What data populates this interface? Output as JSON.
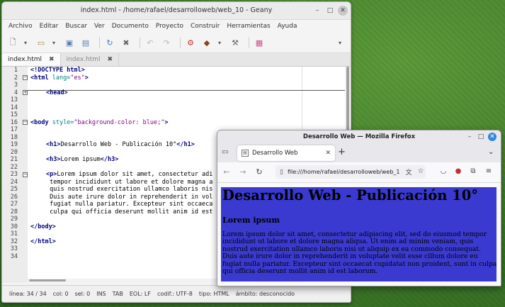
{
  "geany": {
    "title": "index.html - /home/rafael/desarrolloweb/web_10 - Geany",
    "menu": [
      "Archivo",
      "Editar",
      "Buscar",
      "Ver",
      "Documento",
      "Proyecto",
      "Construir",
      "Herramientas",
      "Ayuda"
    ],
    "tabs": [
      {
        "label": "index.html",
        "active": true
      },
      {
        "label": "index.html",
        "active": false
      }
    ],
    "line_numbers": [
      "1",
      "2",
      "3",
      "4",
      "13",
      "14",
      "15",
      "16",
      "17",
      "18",
      "19",
      "20",
      "21",
      "22",
      "23",
      "24",
      "25",
      "26",
      "27",
      "28",
      "29",
      "30",
      "31",
      "32",
      "33",
      "34"
    ],
    "code": {
      "l1": "<!DOCTYPE html>",
      "l2_tag": "<html",
      "l2_attr": " lang=",
      "l2_str": "\"es\"",
      "l2_end": ">",
      "l4": "<head>",
      "l16_tag": "<body",
      "l16_attr": " style=",
      "l16_str": "\"background-color: blue;\"",
      "l16_end": ">",
      "l19_open": "<h1>",
      "l19_text": "Desarrollo Web - Publicación 10°",
      "l19_close": "</h1>",
      "l21_open": "<h3>",
      "l21_text": "Lorem ipsum",
      "l21_close": "</h3>",
      "l23_open": "<p>",
      "l23_text": "Lorem ipsum dolor sit amet, consectetur adi",
      "l24": " tempor incididunt ut labore et dolore magna a",
      "l25": " quis nostrud exercitation ullamco laboris nis",
      "l26": " Duis aute irure dolor in reprehenderit in vol",
      "l27": " fugiat nulla pariatur. Excepteur sint occaeca",
      "l28": " culpa qui officia deserunt mollit anim id est",
      "l30": "</body>",
      "l32": "</html>"
    },
    "status": [
      "línea: 34 / 34",
      "col: 0",
      "sel: 0",
      "INS",
      "TAB",
      "EOL: LF",
      "codif.: UTF-8",
      "tipo: HTML",
      "ámbito: desconocido"
    ]
  },
  "firefox": {
    "title": "Desarrollo Web — Mozilla Firefox",
    "tab_label": "Desarrollo Web",
    "url": "file:///home/rafael/desarrolloweb/web_1",
    "page": {
      "h1": "Desarrollo Web - Publicación 10°",
      "h3": "Lorem ipsum",
      "p": "Lorem ipsum dolor sit amet, consectetur adipiscing elit, sed do eiusmod tempor incididunt ut labore et dolore magna aliqua. Ut enim ad minim veniam, quis nostrud exercitation ullamco laboris nisi ut aliquip ex ea commodo consequat. Duis aute irure dolor in reprehenderit in voluptate velit esse cillum dolore eu fugiat nulla pariatur. Excepteur sint occaecat cupidatat non proident, sunt in culpa qui officia deserunt mollit anim id est laborum.",
      "background": "#3a3ad0"
    }
  }
}
